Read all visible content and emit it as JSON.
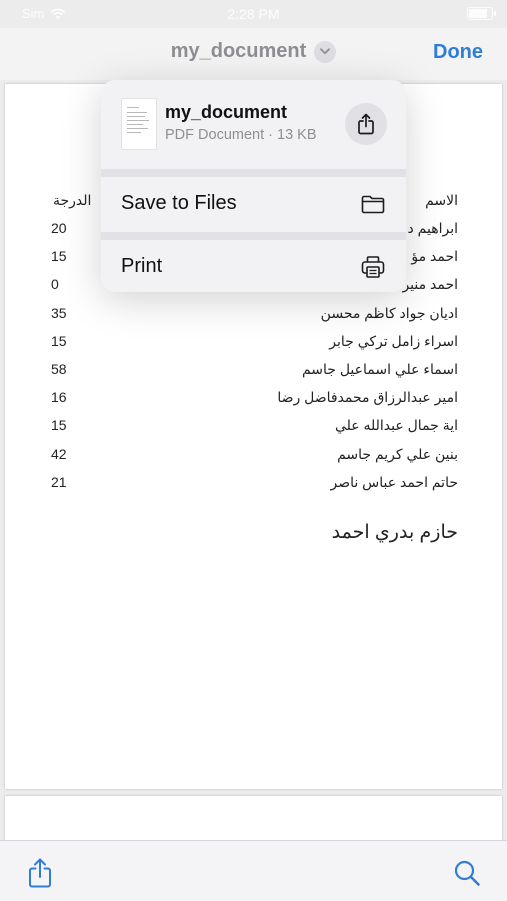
{
  "status_bar": {
    "carrier": "Sim",
    "time": "2:28 PM"
  },
  "nav": {
    "title": "my_document",
    "done_label": "Done"
  },
  "popover": {
    "file_name": "my_document",
    "file_info": "PDF Document · 13 KB",
    "items": [
      {
        "label": "Save to Files",
        "icon": "folder-icon"
      },
      {
        "label": "Print",
        "icon": "printer-icon"
      }
    ]
  },
  "document": {
    "headers": {
      "grade": "الدرجة",
      "name": "الاسم"
    },
    "rows": [
      {
        "grade": "20",
        "name": "ابراهيم د"
      },
      {
        "grade": "15",
        "name": "احمد مؤ"
      },
      {
        "grade": "0",
        "name": "احمد منير"
      },
      {
        "grade": "35",
        "name": "اديان جواد كاظم محسن"
      },
      {
        "grade": "15",
        "name": "اسراء زامل تركي جابر"
      },
      {
        "grade": "58",
        "name": "اسماء علي اسماعيل جاسم"
      },
      {
        "grade": "16",
        "name": "امير عبدالرزاق محمدفاضل رضا"
      },
      {
        "grade": "15",
        "name": "اية جمال عبدالله علي"
      },
      {
        "grade": "42",
        "name": "بنين علي كريم جاسم"
      },
      {
        "grade": "21",
        "name": "حاتم احمد عباس ناصر"
      }
    ],
    "trailing_name": "حازم بدري احمد"
  },
  "icons": {
    "share": "share-icon",
    "search": "search-icon",
    "chevron": "chevron-down-icon"
  },
  "colors": {
    "accent": "#2f7dd6"
  }
}
